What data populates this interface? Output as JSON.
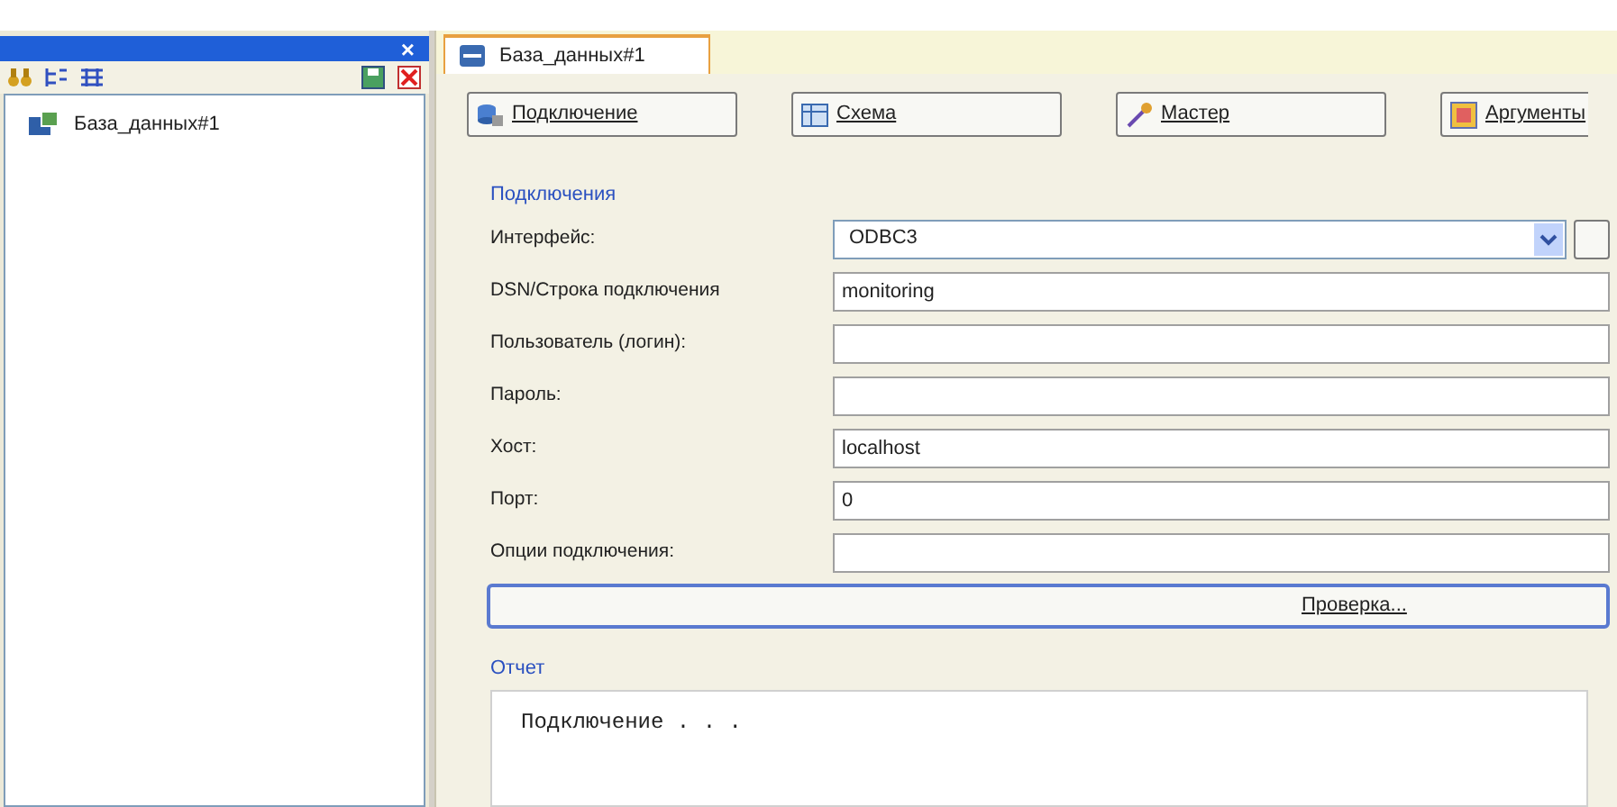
{
  "left_panel": {
    "close": "×",
    "tree": [
      {
        "label": "База_данных#1",
        "selected": false
      }
    ]
  },
  "tabs": [
    {
      "label": "База_данных#1",
      "selected": true
    }
  ],
  "toolbar_buttons": [
    {
      "label": "Подключение",
      "kind": "connect"
    },
    {
      "label": "Схема",
      "kind": "schema"
    },
    {
      "label": "Мастер",
      "kind": "wizard"
    },
    {
      "label": "Аргументы",
      "kind": "args"
    }
  ],
  "connection_group": {
    "title": "Подключения",
    "fields": [
      {
        "label": "Интерфейс:",
        "value": "ODBC3",
        "kind": "combo"
      },
      {
        "label": "DSN/Строка подключения",
        "value": "monitoring",
        "kind": "text"
      },
      {
        "label": "Пользователь (логин):",
        "kind": "text"
      },
      {
        "label": "Пароль:",
        "kind": "text"
      },
      {
        "label": "Хост:",
        "value": "localhost",
        "kind": "text"
      },
      {
        "label": "Порт:",
        "value": "0",
        "kind": "text"
      },
      {
        "label": "Опции подключения:",
        "kind": "text"
      }
    ],
    "check_button": "Проверка..."
  },
  "report": {
    "title": "Отчет",
    "text": "Подключение . . ."
  }
}
